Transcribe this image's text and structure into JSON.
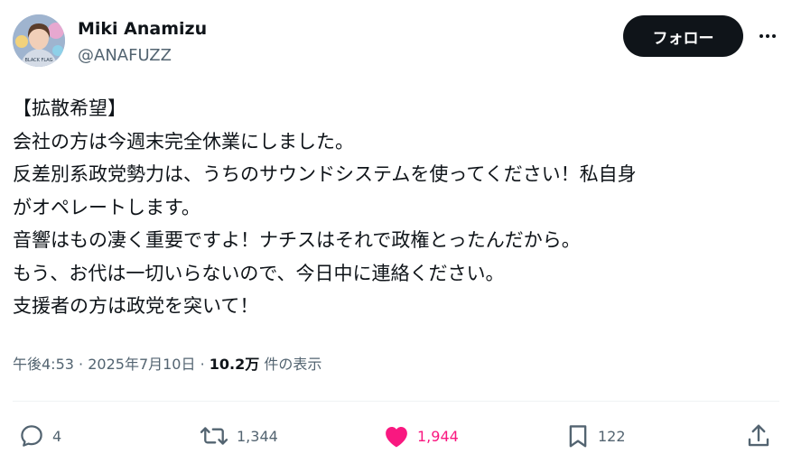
{
  "user": {
    "display_name": "Miki Anamizu",
    "handle": "@ANAFUZZ",
    "avatar_shirt_text": "BLACK FLAG"
  },
  "follow_button": {
    "label": "フォロー"
  },
  "more_icon": "more-horizontal-icon",
  "tweet": {
    "lines": [
      "【拡散希望】",
      "会社の方は今週末完全休業にしました。",
      "反差別系政党勢力は、うちのサウンドシステムを使ってください！私自身",
      "がオペレートします。",
      "音響はもの凄く重要ですよ！ナチスはそれで政権とったんだから。",
      "もう、お代は一切いらないので、今日中に連絡ください。",
      "支援者の方は政党を突いて！"
    ]
  },
  "meta": {
    "time": "午後4:53",
    "separator": "·",
    "date": "2025年7月10日",
    "views": "10.2万",
    "views_label": "件の表示"
  },
  "actions": {
    "reply": {
      "icon": "reply-icon",
      "count": "4"
    },
    "retweet": {
      "icon": "retweet-icon",
      "count": "1,344"
    },
    "like": {
      "icon": "heart-icon",
      "count": "1,944",
      "color": "#f91880"
    },
    "bookmark": {
      "icon": "bookmark-icon",
      "count": "122"
    },
    "share": {
      "icon": "share-icon"
    }
  },
  "colors": {
    "text": "#0f1419",
    "secondary": "#536471",
    "like": "#f91880",
    "button_bg": "#0f1419",
    "divider": "#eff3f4"
  }
}
